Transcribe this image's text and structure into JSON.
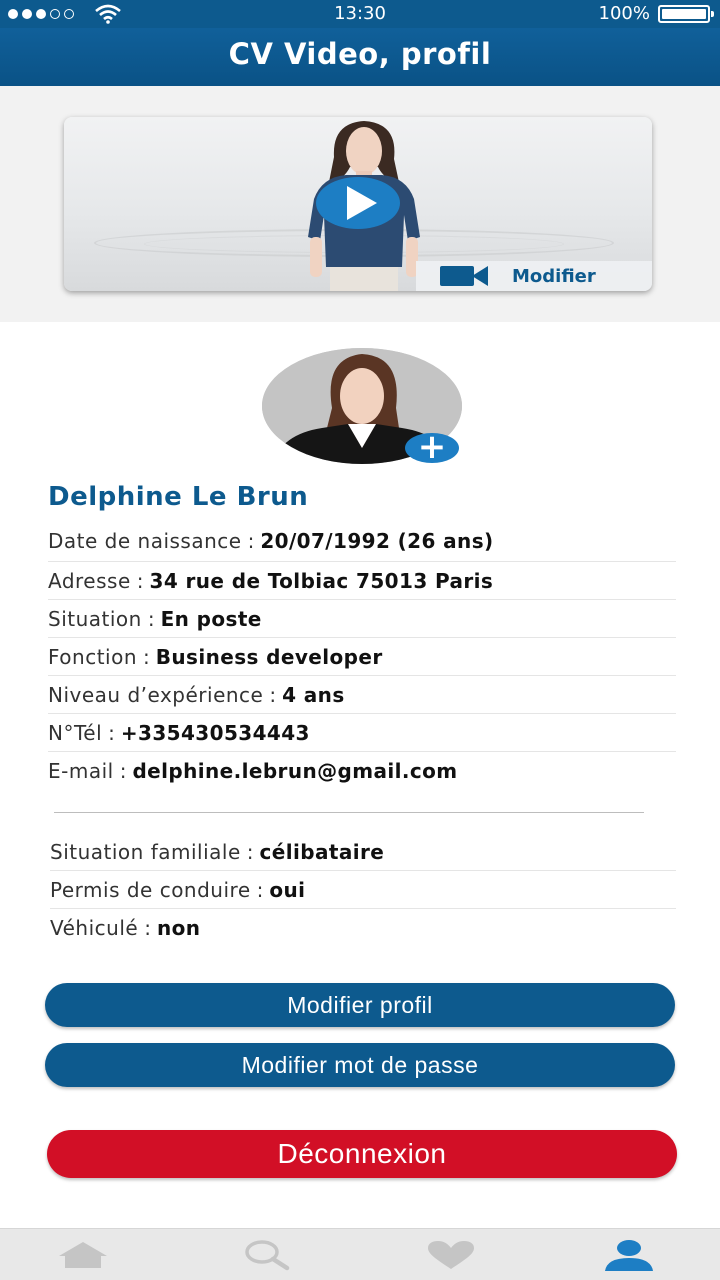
{
  "status": {
    "time": "13:30",
    "battery": "100%"
  },
  "header": {
    "title": "CV Video, profil"
  },
  "video": {
    "edit_label": "Modifier"
  },
  "profile": {
    "name": "Delphine Le Brun",
    "fields": [
      {
        "label": "Date de naissance",
        "value": "20/07/1992 (26 ans)"
      },
      {
        "label": "Adresse",
        "value": "34 rue de Tolbiac 75013 Paris"
      },
      {
        "label": "Situation",
        "value": "En poste"
      },
      {
        "label": "Fonction",
        "value": "Business developer"
      },
      {
        "label": "Niveau d’expérience",
        "value": "4 ans"
      },
      {
        "label": "N°Tél",
        "value": "+335430534443"
      },
      {
        "label": "E-mail",
        "value": "delphine.lebrun@gmail.com"
      }
    ],
    "extra_fields": [
      {
        "label": "Situation familiale",
        "value": "célibataire"
      },
      {
        "label": "Permis de conduire",
        "value": "oui"
      },
      {
        "label": "Véhiculé",
        "value": "non"
      }
    ]
  },
  "actions": {
    "edit_profile": "Modifier profil",
    "edit_password": "Modifier mot de passe",
    "logout": "Déconnexion"
  },
  "tabbar": {
    "items": [
      {
        "icon": "home-icon"
      },
      {
        "icon": "search-icon"
      },
      {
        "icon": "heart-icon"
      },
      {
        "icon": "user-icon",
        "active": true
      }
    ]
  },
  "colors": {
    "brand": "#0d5a8e",
    "accent": "#1d7ec4",
    "danger": "#d20f26"
  }
}
